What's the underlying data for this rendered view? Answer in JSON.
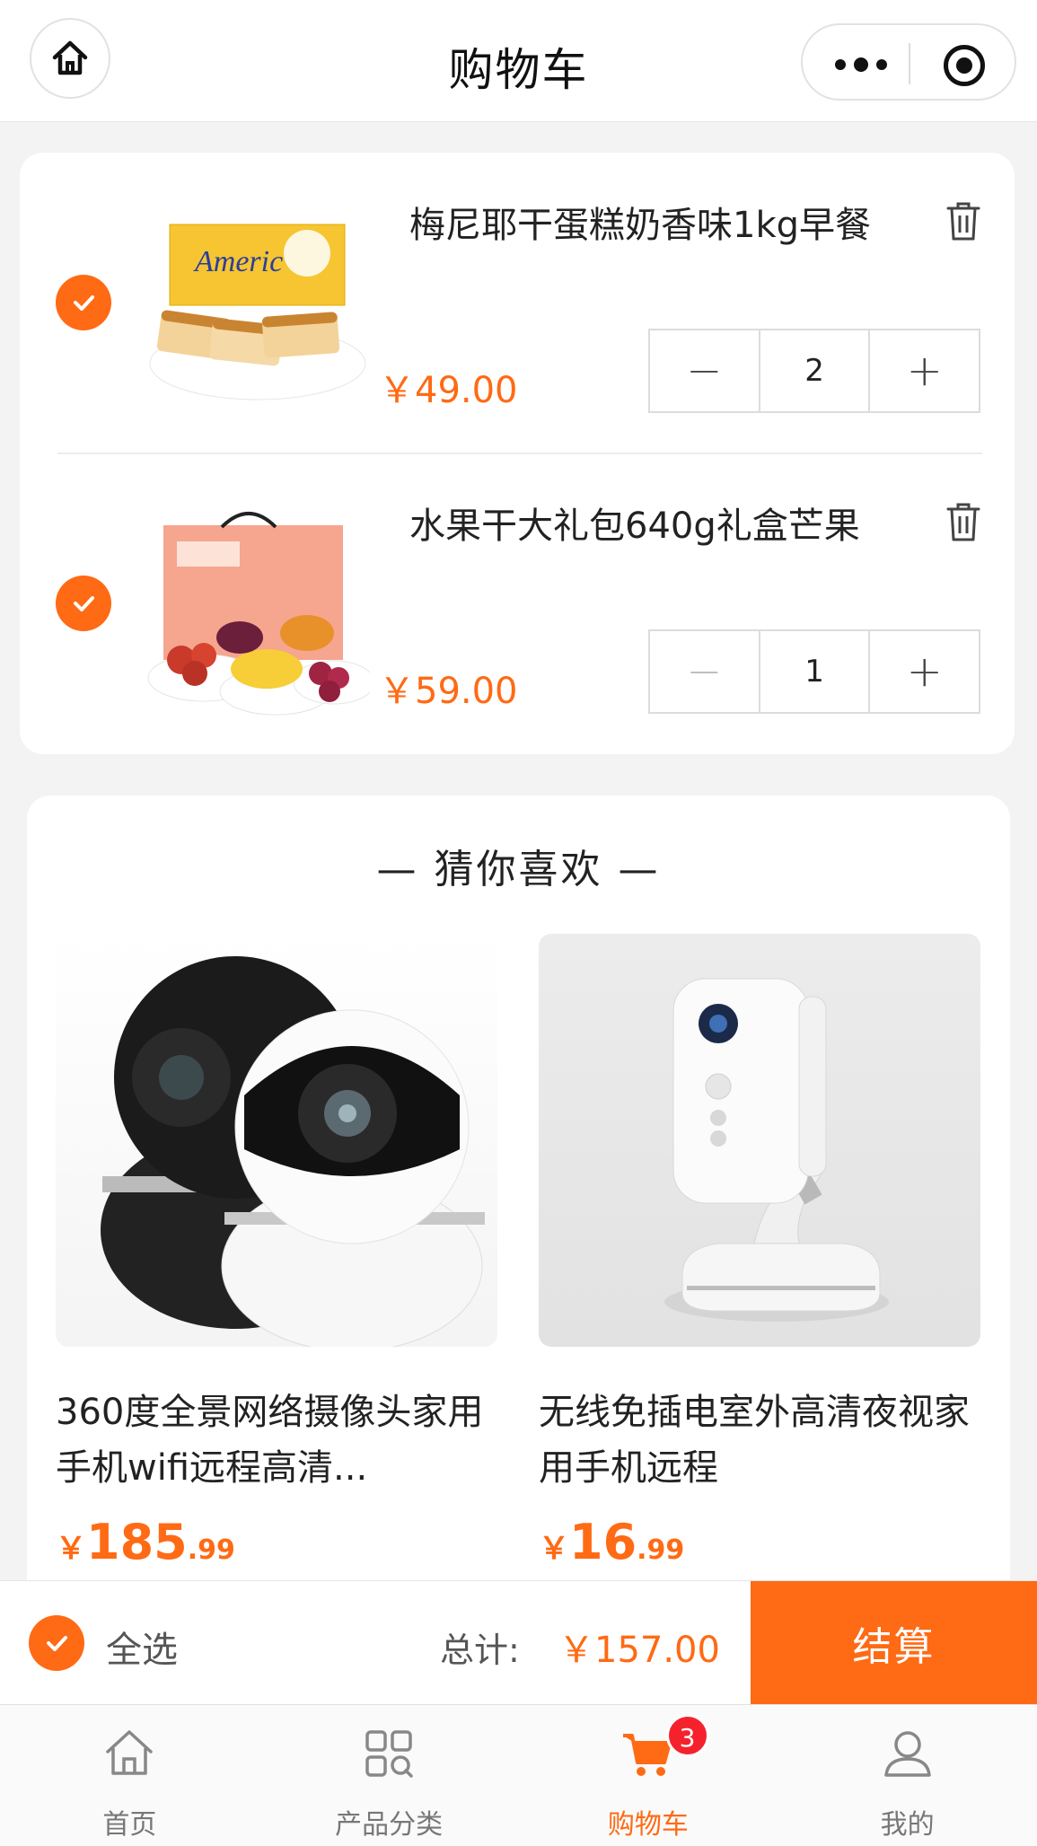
{
  "header": {
    "title": "购物车"
  },
  "cart": {
    "items": [
      {
        "name": "梅尼耶干蛋糕奶香味1kg早餐",
        "price": "￥49.00",
        "quantity": "2",
        "checked": true
      },
      {
        "name": "水果干大礼包640g礼盒芒果",
        "price": "￥59.00",
        "quantity": "1",
        "checked": true
      }
    ]
  },
  "recommend": {
    "title": "—  猜你喜欢  —",
    "products": [
      {
        "name": "360度全景网络摄像头家用手机wifi远程高清...",
        "currency": "￥",
        "price_int": "185",
        "price_dec": ".99"
      },
      {
        "name": "无线免插电室外高清夜视家用手机远程",
        "currency": "￥",
        "price_int": "16",
        "price_dec": ".99"
      }
    ]
  },
  "checkout": {
    "select_all": "全选",
    "total_label": "总计:",
    "total_value": "￥157.00",
    "pay_label": "结算"
  },
  "tabbar": {
    "items": [
      {
        "label": "首页",
        "icon": "home-icon"
      },
      {
        "label": "产品分类",
        "icon": "category-grid-icon"
      },
      {
        "label": "购物车",
        "icon": "cart-icon",
        "active": true,
        "badge": "3"
      },
      {
        "label": "我的",
        "icon": "user-icon"
      }
    ]
  },
  "colors": {
    "accent": "#ff6a14",
    "badge": "#f5222d"
  }
}
